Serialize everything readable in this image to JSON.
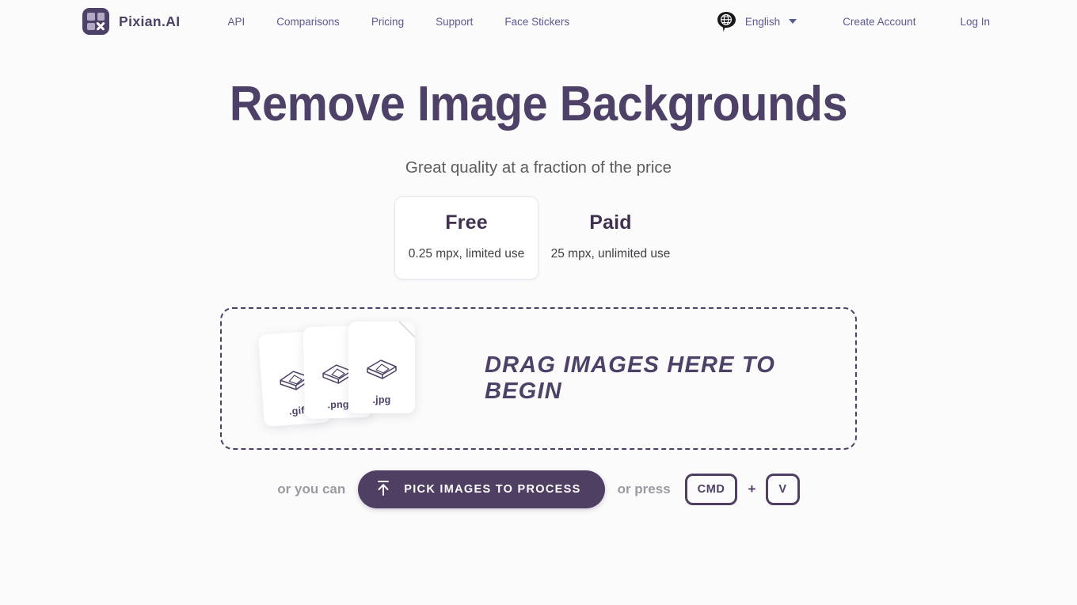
{
  "brand": {
    "name": "Pixian.AI",
    "logo_icon": "pixian-grid-x-logo-icon",
    "logo_bg": "#4e4168"
  },
  "header": {
    "nav_links": [
      {
        "label": "API"
      },
      {
        "label": "Comparisons"
      },
      {
        "label": "Pricing"
      },
      {
        "label": "Support"
      },
      {
        "label": "Face Stickers"
      }
    ],
    "language": {
      "icon": "globe-speech-bubble-icon",
      "label": "English",
      "caret_icon": "chevron-down-icon"
    },
    "create_account": "Create Account",
    "log_in": "Log In",
    "link_color": "#5b5b93"
  },
  "hero": {
    "title": "Remove Image Backgrounds",
    "subtitle": "Great quality at a fraction of the price",
    "title_color": "#4e4168"
  },
  "plans": {
    "options": [
      {
        "title": "Free",
        "description": "0.25 mpx, limited use",
        "selected": true
      },
      {
        "title": "Paid",
        "description": "25 mpx, unlimited use",
        "selected": false
      }
    ]
  },
  "dropzone": {
    "message": "DRAG IMAGES HERE TO BEGIN",
    "border_color": "#4e4168",
    "files": [
      {
        "label": ".gif",
        "icon": "image-stack-icon"
      },
      {
        "label": ".png",
        "icon": "image-stack-icon"
      },
      {
        "label": ".jpg",
        "icon": "image-stack-icon"
      }
    ]
  },
  "actions": {
    "prefix_text": "or you can",
    "pick_button": {
      "label": "PICK IMAGES TO PROCESS",
      "icon": "upload-arrow-icon",
      "bg": "#4e3f63",
      "text_color": "#ffffff"
    },
    "press_text": "or press",
    "keys": [
      {
        "label": "CMD"
      },
      {
        "label": "V"
      }
    ],
    "key_separator": "+"
  }
}
